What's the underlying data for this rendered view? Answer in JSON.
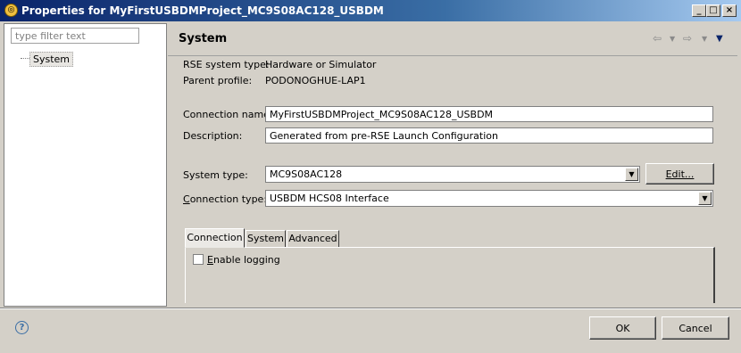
{
  "window": {
    "title": "Properties for MyFirstUSBDMProject_MC9S08AC128_USBDM",
    "minimize_glyph": "_",
    "maximize_glyph": "□",
    "close_glyph": "×"
  },
  "sidebar": {
    "filter_placeholder": "type filter text",
    "items": [
      {
        "label": "System"
      }
    ]
  },
  "page": {
    "title": "System",
    "info": {
      "rse_system_type_label": "RSE system type:",
      "rse_system_type_value": "Hardware or Simulator",
      "parent_profile_label": "Parent profile:",
      "parent_profile_value": "PODONOGHUE-LAP1"
    },
    "connection_name": {
      "label": "Connection name:",
      "value": "MyFirstUSBDMProject_MC9S08AC128_USBDM"
    },
    "description": {
      "label": "Description:",
      "value": "Generated from pre-RSE Launch Configuration"
    },
    "system_type": {
      "label": "System type:",
      "value": "MC9S08AC128",
      "edit_button": "Edit..."
    },
    "connection_type": {
      "label_first": "C",
      "label_rest": "onnection type:",
      "value": "USBDM HCS08 Interface"
    },
    "tabs": [
      {
        "label": "Connection"
      },
      {
        "label": "System"
      },
      {
        "label": "Advanced"
      }
    ],
    "enable_logging": {
      "label_first": "E",
      "label_rest": "nable logging",
      "checked": false
    }
  },
  "footer": {
    "ok": "OK",
    "cancel": "Cancel"
  },
  "icons": {
    "app": "app-icon",
    "back": "back-arrow-icon",
    "forward": "forward-arrow-icon",
    "menu": "view-menu-icon",
    "help": "help-icon"
  }
}
